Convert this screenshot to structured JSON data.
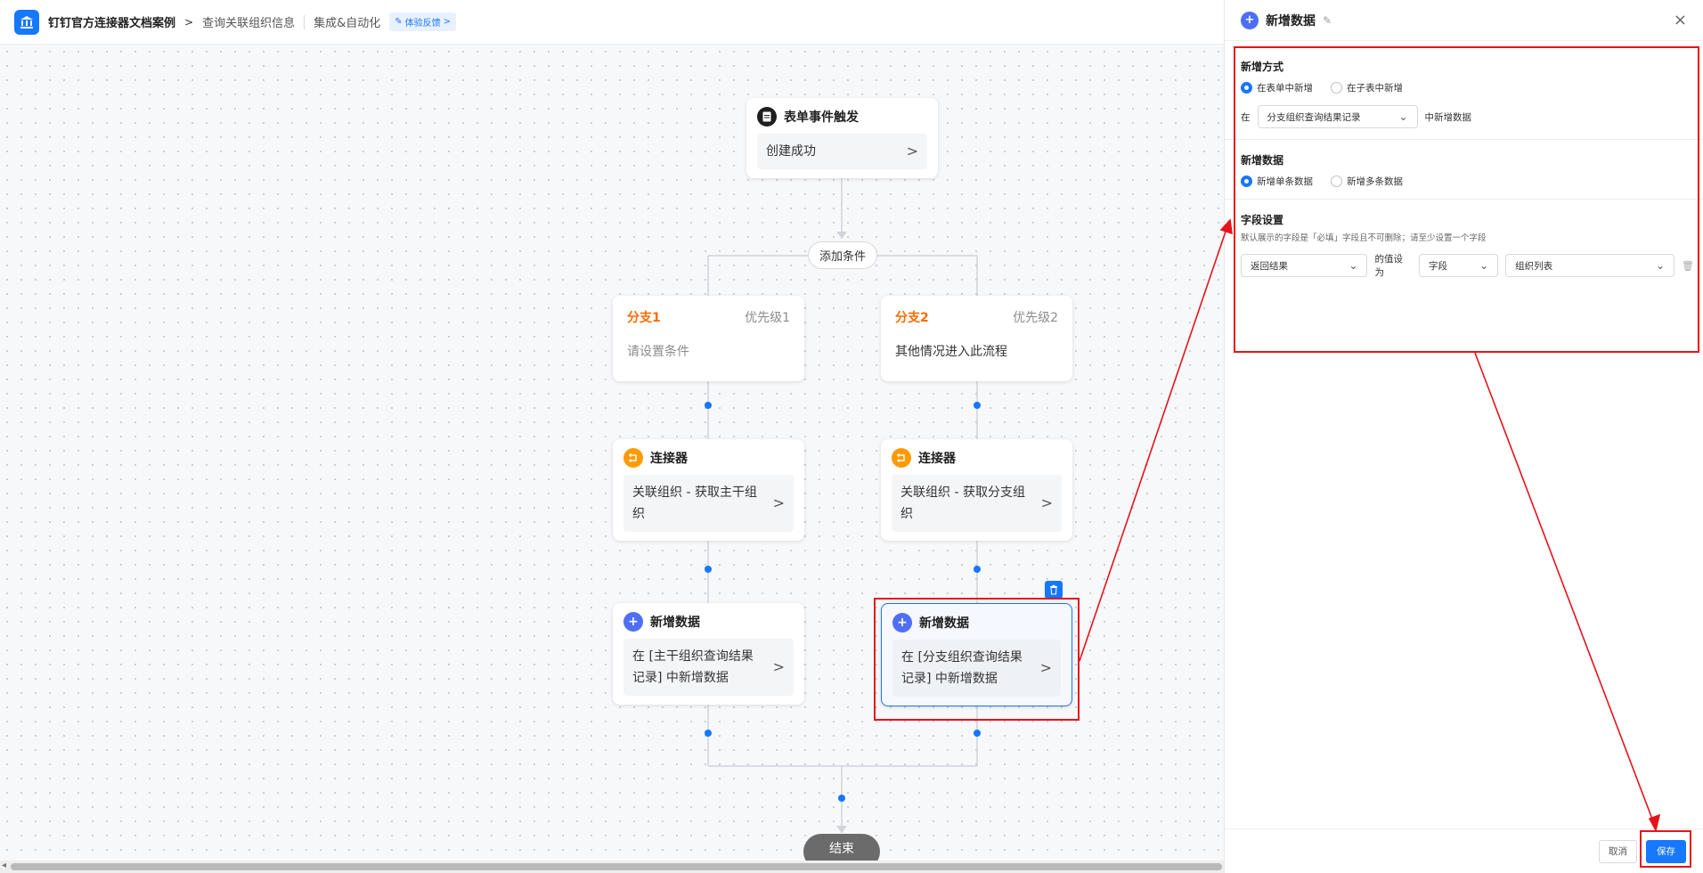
{
  "topbar": {
    "app_name": "钉钉官方连接器文档案例",
    "separator": ">",
    "page_name": "查询关联组织信息",
    "section_link": "集成&自动化",
    "feedback_label": "体验反馈",
    "feedback_arrow": ">"
  },
  "flow": {
    "trigger": {
      "title": "表单事件触发",
      "body": "创建成功"
    },
    "add_condition": "添加条件",
    "branches": [
      {
        "name": "分支1",
        "priority": "优先级1",
        "condition": "请设置条件",
        "connector": {
          "title": "连接器",
          "body": "关联组织 - 获取主干组织"
        },
        "add_data": {
          "title": "新增数据",
          "body": "在 [主干组织查询结果记录] 中新增数据"
        }
      },
      {
        "name": "分支2",
        "priority": "优先级2",
        "condition": "其他情况进入此流程",
        "connector": {
          "title": "连接器",
          "body": "关联组织 - 获取分支组织"
        },
        "add_data": {
          "title": "新增数据",
          "body": "在 [分支组织查询结果记录] 中新增数据"
        }
      }
    ],
    "end_label": "结束",
    "chevron": ">"
  },
  "panel": {
    "title": "新增数据",
    "close": "×",
    "method": {
      "title": "新增方式",
      "options": [
        "在表单中新增",
        "在子表中新增"
      ],
      "selected_index": 0,
      "prefix": "在",
      "form_select": "分支组织查询结果记录",
      "suffix": "中新增数据"
    },
    "data": {
      "title": "新增数据",
      "options": [
        "新增单条数据",
        "新增多条数据"
      ],
      "selected_index": 0
    },
    "fields": {
      "title": "字段设置",
      "hint": "默认展示的字段是「必填」字段且不可删除；请至少设置一个字段",
      "field_select": "返回结果",
      "value_label": "的值设为",
      "type_select": "字段",
      "value_select": "组织列表"
    },
    "footer": {
      "cancel": "取消",
      "save": "保存"
    }
  },
  "colors": {
    "accent": "#1677ff",
    "branch_name": "#ff6a00",
    "connector_icon": "#ff9a00",
    "add_icon": "#4f6ef7",
    "annotation_red": "#e5131b"
  }
}
